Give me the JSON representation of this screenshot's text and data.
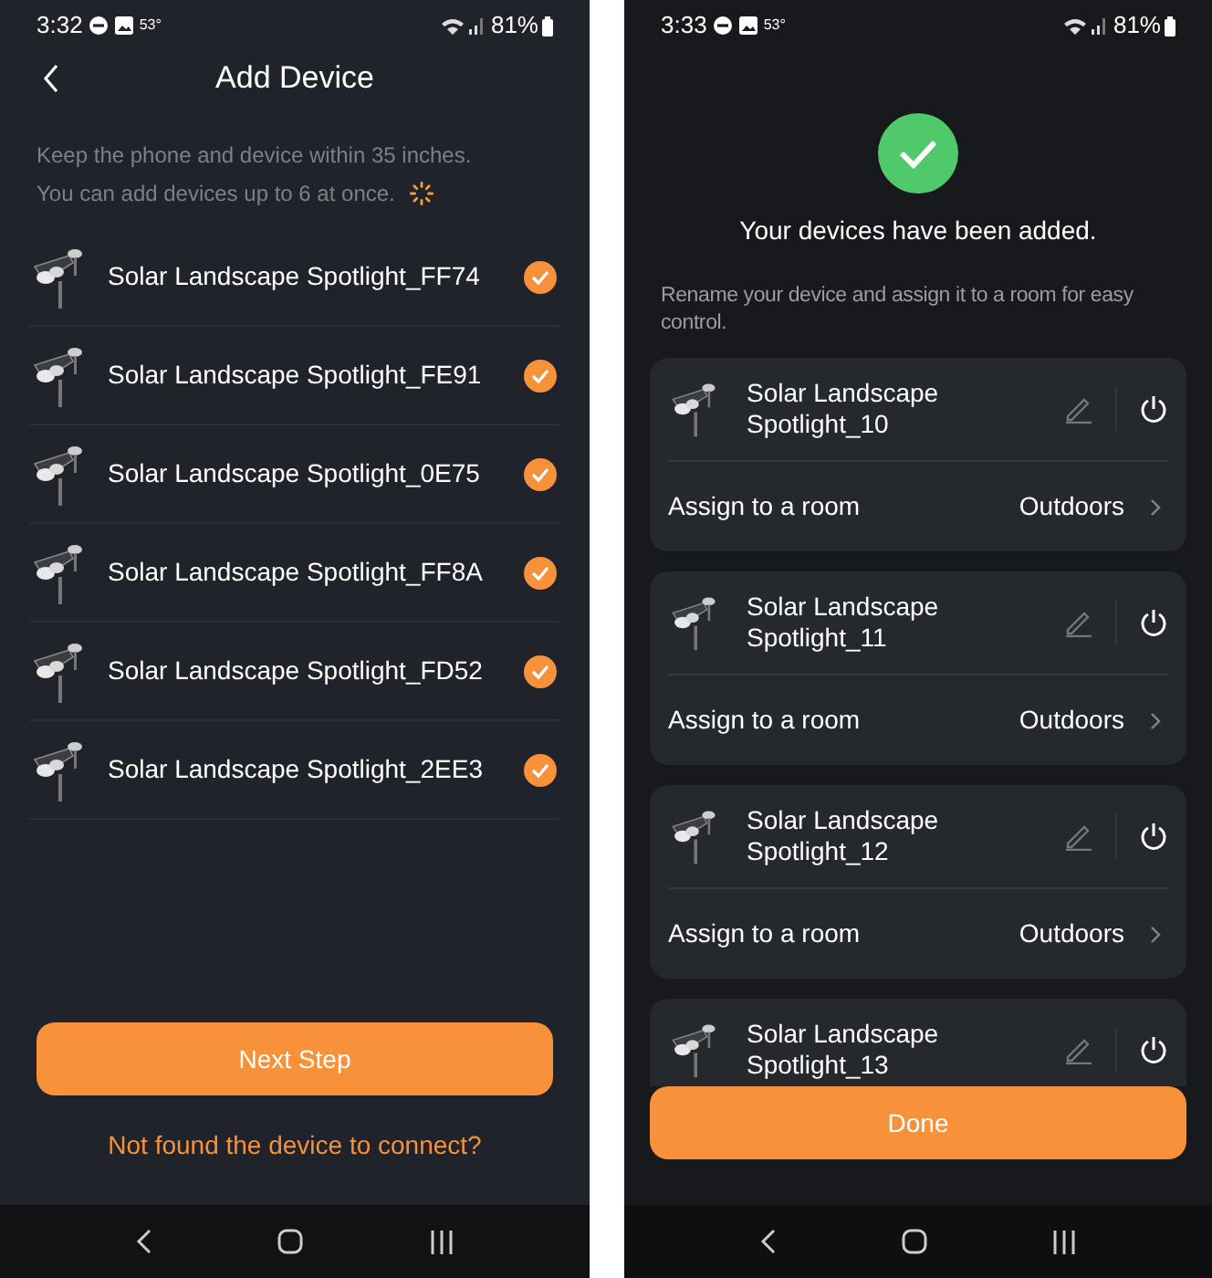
{
  "screens": [
    {
      "kind": "scan",
      "status_bar": {
        "time": "3:32",
        "temperature": "53°",
        "battery": "81%"
      },
      "title": "Add Device",
      "hints": [
        "Keep the phone and device within 35 inches.",
        "You can add devices up to 6 at once."
      ],
      "loading": true,
      "devices": [
        {
          "name": "Solar Landscape Spotlight_FF74",
          "checked": true
        },
        {
          "name": "Solar Landscape Spotlight_FE91",
          "checked": true
        },
        {
          "name": "Solar Landscape Spotlight_0E75",
          "checked": true
        },
        {
          "name": "Solar Landscape Spotlight_FF8A",
          "checked": true
        },
        {
          "name": "Solar Landscape Spotlight_FD52",
          "checked": true
        },
        {
          "name": "Solar Landscape Spotlight_2EE3",
          "checked": true
        }
      ],
      "button": "Next Step",
      "link": "Not found the device to connect?"
    },
    {
      "kind": "added",
      "status_bar": {
        "time": "3:33",
        "temperature": "53°",
        "battery": "81%"
      },
      "message": "Your devices have been added.",
      "description": "Rename your device and assign it to a room for easy control.",
      "cards": [
        {
          "name": "Solar Landscape Spotlight_10",
          "room_label": "Assign to a room",
          "room": "Outdoors"
        },
        {
          "name": "Solar Landscape Spotlight_11",
          "room_label": "Assign to a room",
          "room": "Outdoors"
        },
        {
          "name": "Solar Landscape Spotlight_12",
          "room_label": "Assign to a room",
          "room": "Outdoors"
        },
        {
          "name": "Solar Landscape Spotlight_13"
        }
      ],
      "button": "Done"
    }
  ]
}
